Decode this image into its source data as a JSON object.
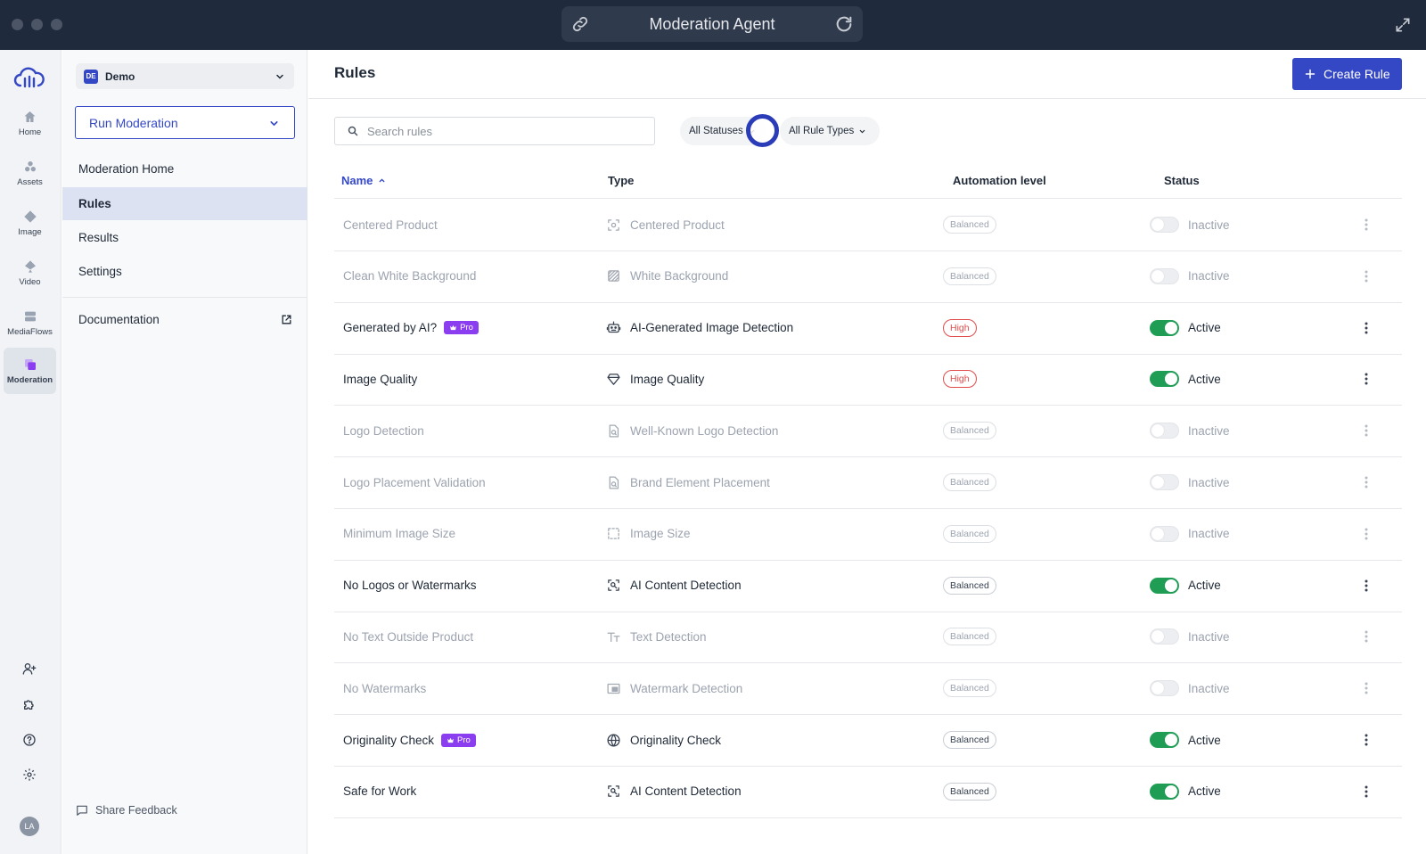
{
  "window": {
    "title": "Moderation Agent"
  },
  "rail": {
    "items": [
      {
        "label": "Home",
        "icon": "home-icon"
      },
      {
        "label": "Assets",
        "icon": "assets-icon"
      },
      {
        "label": "Image",
        "icon": "image-icon"
      },
      {
        "label": "Video",
        "icon": "video-icon"
      },
      {
        "label": "MediaFlows",
        "icon": "mediaflows-icon"
      },
      {
        "label": "Moderation",
        "icon": "moderation-icon",
        "active": true
      }
    ],
    "avatar_initials": "LA"
  },
  "sidebar": {
    "workspace_badge": "DE",
    "workspace_name": "Demo",
    "run_button": "Run Moderation",
    "nav": [
      {
        "label": "Moderation Home"
      },
      {
        "label": "Rules",
        "active": true
      },
      {
        "label": "Results"
      },
      {
        "label": "Settings"
      }
    ],
    "documentation": "Documentation",
    "share_feedback": "Share Feedback"
  },
  "main": {
    "title": "Rules",
    "create_button": "Create Rule",
    "search_placeholder": "Search rules",
    "filters": {
      "status": "All Statuses",
      "type": "All Rule Types"
    },
    "columns": {
      "name": "Name",
      "type": "Type",
      "automation": "Automation level",
      "status": "Status"
    },
    "pro_label": "Pro",
    "rows": [
      {
        "name": "Centered Product",
        "type": "Centered Product",
        "type_icon": "center-focus-icon",
        "automation": "Balanced",
        "status": "Inactive",
        "active": false,
        "pro": false
      },
      {
        "name": "Clean White Background",
        "type": "White Background",
        "type_icon": "background-icon",
        "automation": "Balanced",
        "status": "Inactive",
        "active": false,
        "pro": false
      },
      {
        "name": "Generated by AI?",
        "type": "AI-Generated Image Detection",
        "type_icon": "robot-icon",
        "automation": "High",
        "status": "Active",
        "active": true,
        "pro": true
      },
      {
        "name": "Image Quality",
        "type": "Image Quality",
        "type_icon": "diamond-icon",
        "automation": "High",
        "status": "Active",
        "active": true,
        "pro": false
      },
      {
        "name": "Logo Detection",
        "type": "Well-Known Logo Detection",
        "type_icon": "doc-search-icon",
        "automation": "Balanced",
        "status": "Inactive",
        "active": false,
        "pro": false
      },
      {
        "name": "Logo Placement Validation",
        "type": "Brand Element Placement",
        "type_icon": "doc-search-icon",
        "automation": "Balanced",
        "status": "Inactive",
        "active": false,
        "pro": false
      },
      {
        "name": "Minimum Image Size",
        "type": "Image Size",
        "type_icon": "dashed-square-icon",
        "automation": "Balanced",
        "status": "Inactive",
        "active": false,
        "pro": false
      },
      {
        "name": "No Logos or Watermarks",
        "type": "AI Content Detection",
        "type_icon": "scan-search-icon",
        "automation": "Balanced",
        "status": "Active",
        "active": true,
        "pro": false
      },
      {
        "name": "No Text Outside Product",
        "type": "Text Detection",
        "type_icon": "text-icon",
        "automation": "Balanced",
        "status": "Inactive",
        "active": false,
        "pro": false
      },
      {
        "name": "No Watermarks",
        "type": "Watermark Detection",
        "type_icon": "watermark-icon",
        "automation": "Balanced",
        "status": "Inactive",
        "active": false,
        "pro": false
      },
      {
        "name": "Originality Check",
        "type": "Originality Check",
        "type_icon": "globe-icon",
        "automation": "Balanced",
        "status": "Active",
        "active": true,
        "pro": true
      },
      {
        "name": "Safe for Work",
        "type": "AI Content Detection",
        "type_icon": "scan-search-icon",
        "automation": "Balanced",
        "status": "Active",
        "active": true,
        "pro": false
      }
    ]
  },
  "colors": {
    "accent": "#3448c5",
    "active_toggle": "#1f9d55",
    "high": "#e04b4b",
    "pro": "#8b3df0",
    "titlebar": "#1f2a3c"
  }
}
